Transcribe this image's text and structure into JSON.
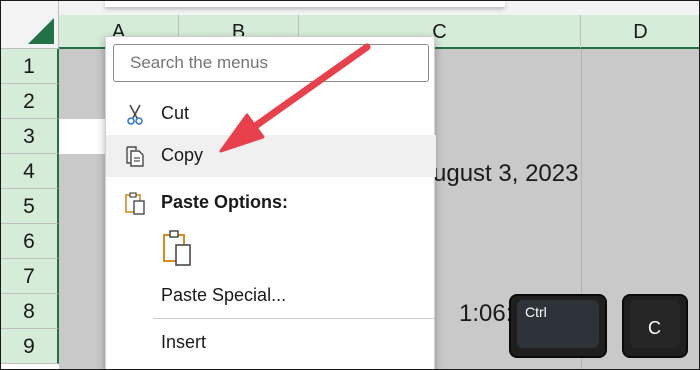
{
  "columns": [
    "A",
    "B",
    "C",
    "D"
  ],
  "rows": [
    "1",
    "2",
    "3",
    "4",
    "5",
    "6",
    "7",
    "8",
    "9"
  ],
  "cells": {
    "c4": "ugust 3, 2023",
    "c8": "1:06:"
  },
  "context_menu": {
    "search_placeholder": "Search the menus",
    "items": {
      "cut": "Cut",
      "copy": "Copy",
      "paste_options": "Paste Options:",
      "paste_special": "Paste Special...",
      "insert": "Insert"
    }
  },
  "keys": {
    "ctrl": "Ctrl",
    "c": "C"
  },
  "colors": {
    "excel_green": "#217346",
    "header_green": "#d5ecd9",
    "arrow_red": "#e8414b",
    "clipboard_orange": "#d98a1f"
  },
  "icons": [
    "select-all-triangle-icon",
    "scissors-icon",
    "copy-icon",
    "clipboard-icon",
    "arrow-annotation-icon"
  ]
}
